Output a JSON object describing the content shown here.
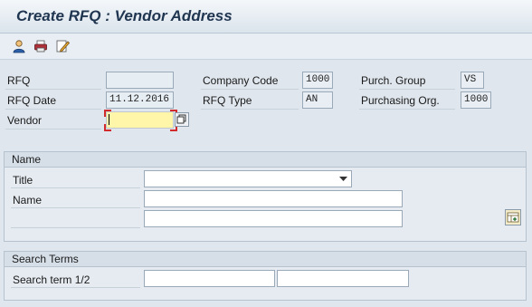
{
  "window": {
    "title": "Create RFQ : Vendor Address"
  },
  "toolbar": {
    "buttons": [
      {
        "icon": "person-icon"
      },
      {
        "icon": "printer-icon"
      },
      {
        "icon": "edit-note-icon"
      }
    ]
  },
  "header": {
    "rfq": {
      "label": "RFQ",
      "value": ""
    },
    "rfq_date": {
      "label": "RFQ Date",
      "value": "11.12.2016"
    },
    "vendor": {
      "label": "Vendor",
      "value": ""
    },
    "company_code": {
      "label": "Company Code",
      "value": "1000"
    },
    "rfq_type": {
      "label": "RFQ Type",
      "value": "AN"
    },
    "purch_group": {
      "label": "Purch. Group",
      "value": "VS"
    },
    "purchasing_org": {
      "label": "Purchasing Org.",
      "value": "1000"
    }
  },
  "name_group": {
    "title": "Name",
    "title_field": {
      "label": "Title",
      "value": ""
    },
    "name_field": {
      "label": "Name",
      "value1": "",
      "value2": ""
    }
  },
  "search_group": {
    "title": "Search Terms",
    "search_term": {
      "label": "Search term 1/2",
      "value1": "",
      "value2": ""
    }
  },
  "colors": {
    "required_marker": "#d12b2b",
    "vendor_field_bg": "#fff6a9",
    "title_text": "#1f3550"
  }
}
